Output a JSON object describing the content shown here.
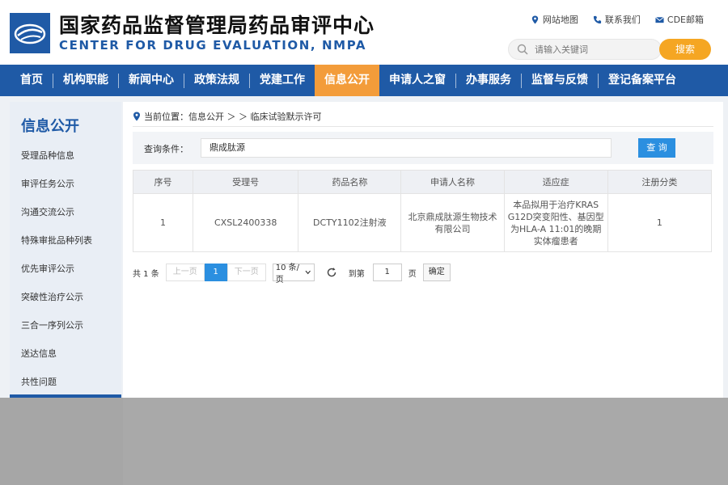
{
  "header": {
    "title_cn": "国家药品监督管理局药品审评中心",
    "title_en": "CENTER FOR DRUG EVALUATION, NMPA",
    "links": [
      "网站地图",
      "联系我们",
      "CDE邮箱"
    ],
    "search_placeholder": "请输入关键词",
    "search_button": "搜索"
  },
  "nav": {
    "items": [
      "首页",
      "机构职能",
      "新闻中心",
      "政策法规",
      "党建工作",
      "信息公开",
      "申请人之窗",
      "办事服务",
      "监督与反馈",
      "登记备案平台"
    ],
    "active": "信息公开"
  },
  "sidebar": {
    "title": "信息公开",
    "items": [
      "受理品种信息",
      "审评任务公示",
      "沟通交流公示",
      "特殊审批品种列表",
      "优先审评公示",
      "突破性治疗公示",
      "三合一序列公示",
      "送达信息",
      "共性问题"
    ]
  },
  "breadcrumb": {
    "text": "当前位置：信息公开 ＞ ＞ 临床试验默示许可"
  },
  "query": {
    "label": "查询条件：",
    "value": "鼎成肽源",
    "button": "查 询"
  },
  "table": {
    "headers": [
      "序号",
      "受理号",
      "药品名称",
      "申请人名称",
      "适应症",
      "注册分类"
    ],
    "rows": [
      {
        "seq": "1",
        "acceptance_no": "CXSL2400338",
        "drug_name": "DCTY1102注射液",
        "applicant": "北京鼎成肽源生物技术有限公司",
        "indication": "本品拟用于治疗KRAS G12D突变阳性、基因型为HLA-A 11:01的晚期实体瘤患者",
        "category": "1"
      }
    ]
  },
  "pager": {
    "total": "共 1 条",
    "prev": "上一页",
    "current": "1",
    "next": "下一页",
    "page_size": "10 条/页",
    "goto": "到第",
    "goto_value": "1",
    "page_label": "页",
    "confirm": "确定"
  },
  "colors": {
    "brand_blue": "#1f5aa6",
    "accent_orange": "#f39c3a",
    "button_blue": "#2b8fe0"
  }
}
